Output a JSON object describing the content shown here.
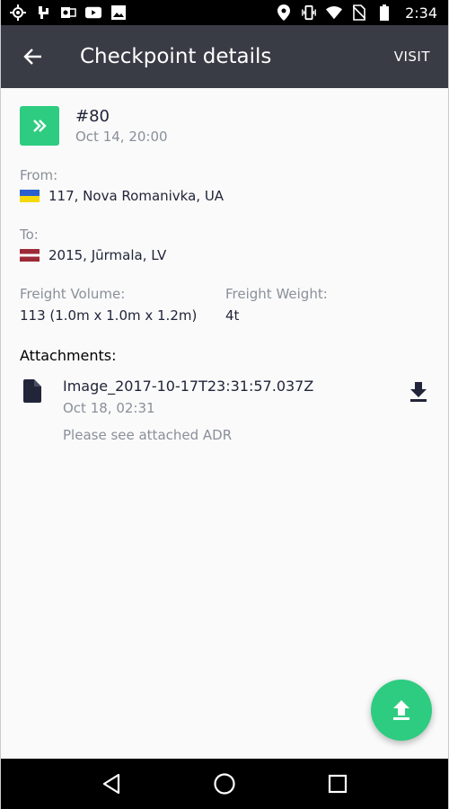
{
  "status_bar": {
    "time": "2:34",
    "left_icons": [
      "gps-icon",
      "usb-icon",
      "outlook-icon",
      "youtube-icon",
      "image-icon"
    ],
    "right_icons": [
      "location-icon",
      "vibrate-icon",
      "wifi-icon",
      "no-sim-icon",
      "battery-icon"
    ]
  },
  "app_bar": {
    "title": "Checkpoint details",
    "action_label": "VISIT"
  },
  "checkpoint": {
    "number": "#80",
    "date": "Oct 14, 20:00"
  },
  "from": {
    "label": "From:",
    "value": "117, Nova Romanivka, UA",
    "flag": "UA"
  },
  "to": {
    "label": "To:",
    "value": "2015, Jūrmala, LV",
    "flag": "LV"
  },
  "freight": {
    "volume_label": "Freight Volume:",
    "volume_value": "113 (1.0m x 1.0m x 1.2m)",
    "weight_label": "Freight Weight:",
    "weight_value": "4t"
  },
  "attachments": {
    "label": "Attachments:",
    "items": [
      {
        "name": "Image_2017-10-17T23:31:57.037Z",
        "date": "Oct 18, 02:31",
        "note": "Please see attached ADR"
      }
    ]
  },
  "colors": {
    "app_bar": "#393c45",
    "accent": "#2ecc80",
    "primary_text": "#22253a",
    "secondary_text": "#8a8f99"
  }
}
